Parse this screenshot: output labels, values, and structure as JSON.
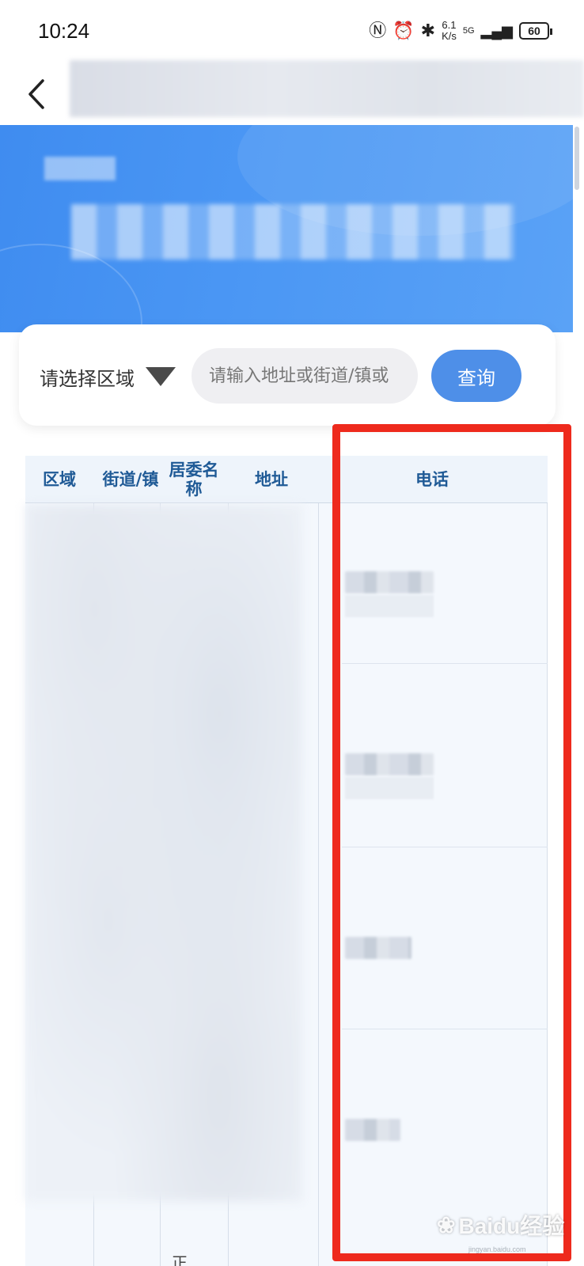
{
  "status_bar": {
    "time": "10:24",
    "icons": [
      "nfc-icon",
      "alarm-icon",
      "bluetooth-icon",
      "signal-icon"
    ],
    "net_speed_value": "6.1",
    "net_speed_unit": "K/s",
    "network": "5G",
    "battery": "60"
  },
  "nav": {
    "back_icon": "chevron-left-icon"
  },
  "search": {
    "region_label": "请选择区域",
    "input_placeholder": "请输入地址或街道/镇或",
    "query_label": "查询"
  },
  "table": {
    "columns": [
      "区域",
      "街道/镇",
      "居委名称",
      "地址",
      "电话"
    ],
    "partial_cell_text": "正"
  },
  "watermark": {
    "brand": "Baidu经验",
    "url": "jingyan.baidu.com"
  },
  "colors": {
    "banner": "#4b97f4",
    "accent_button": "#4e8fe8",
    "header_text": "#1f5a96",
    "highlight": "#ee2a1d"
  }
}
